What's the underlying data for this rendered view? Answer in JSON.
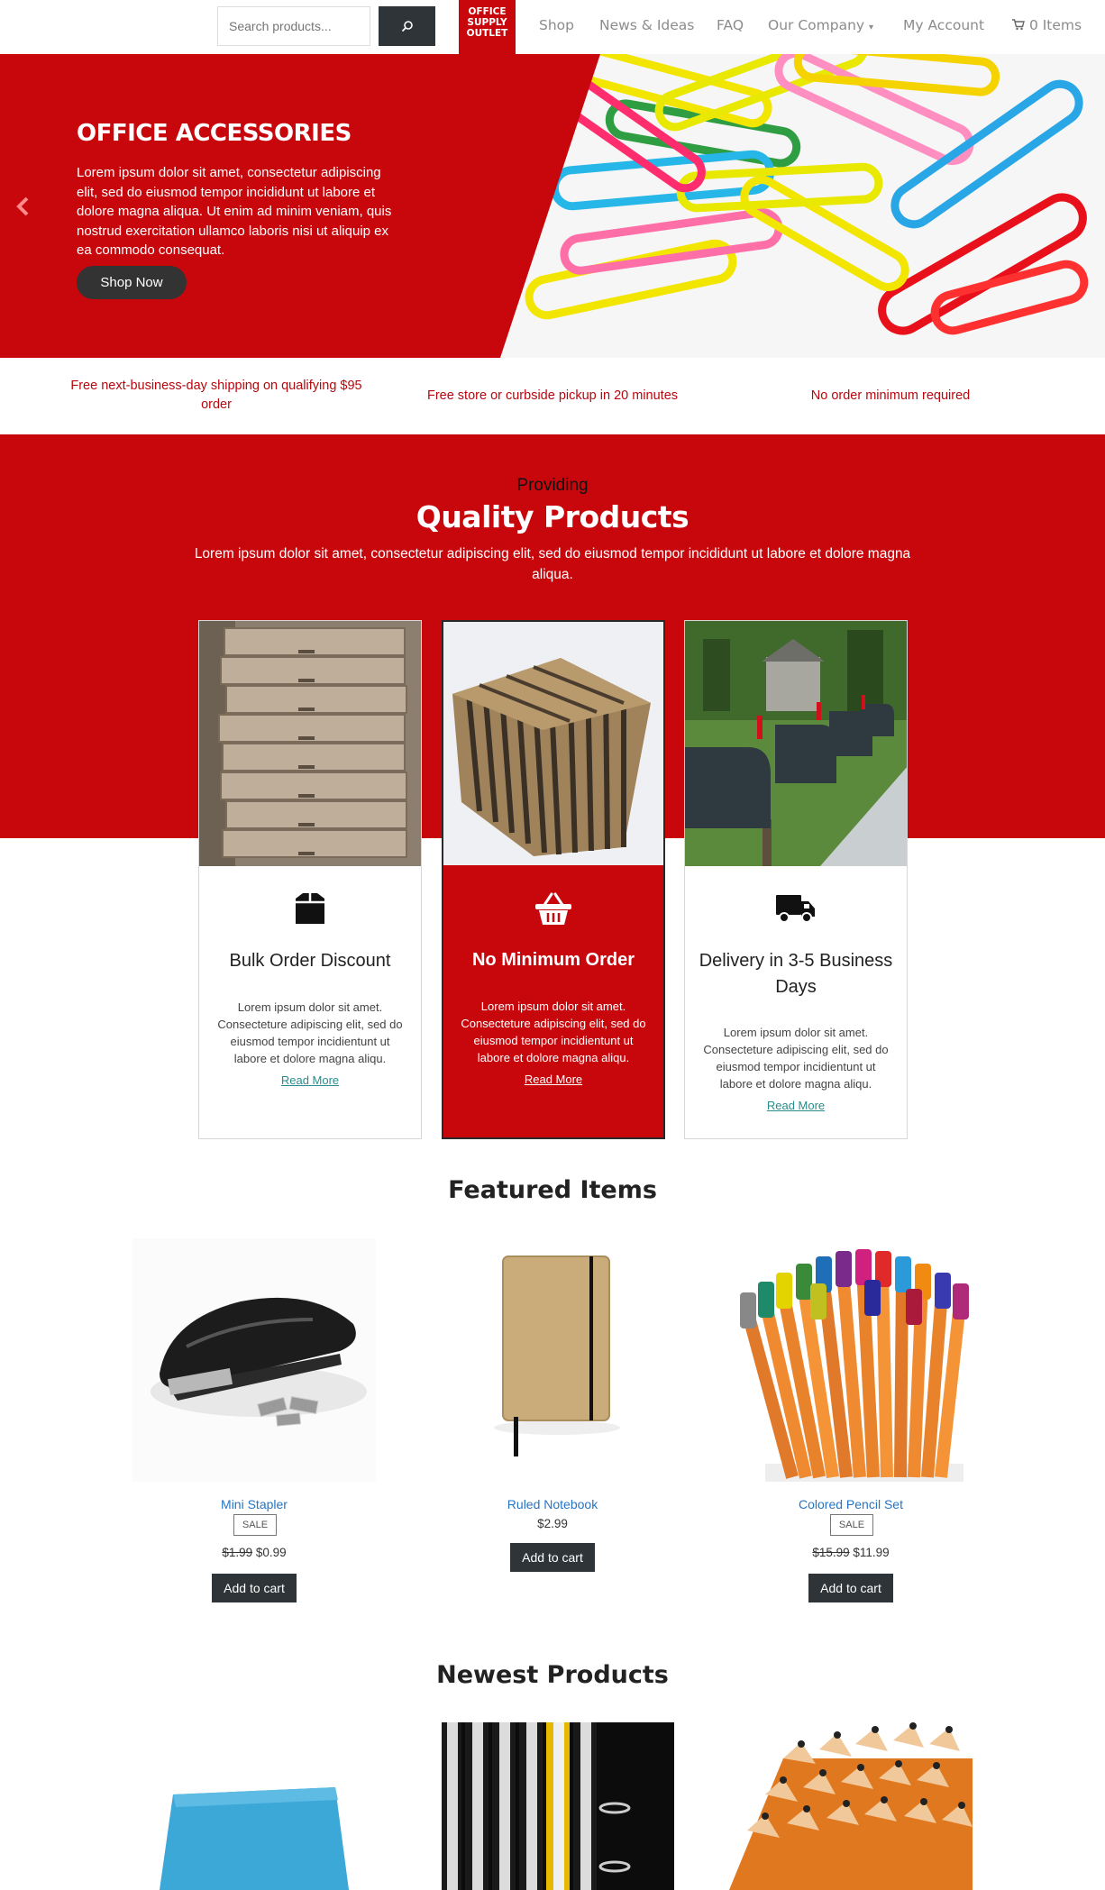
{
  "header": {
    "search_placeholder": "Search products...",
    "logo_line1": "OFFICE",
    "logo_line2": "SUPPLY",
    "logo_line3": "OUTLET",
    "nav": [
      "Shop",
      "News & Ideas",
      "FAQ",
      "Our Company",
      "My Account"
    ],
    "cart_label": "0 Items"
  },
  "hero": {
    "title": "OFFICE ACCESSORIES",
    "text": "Lorem ipsum dolor sit amet, consectetur adipiscing elit, sed do eiusmod tempor incididunt ut labore et dolore magna aliqua. Ut enim ad minim veniam, quis nostrud exercitation ullamco laboris nisi ut aliquip ex ea commodo consequat.",
    "button": "Shop Now"
  },
  "features": [
    "Free next-business-day shipping on qualifying $95 order",
    "Free store or curbside pickup in 20 minutes",
    "No order minimum required"
  ],
  "quality": {
    "kicker": "Providing",
    "title": "Quality Products",
    "text": "Lorem ipsum dolor sit amet, consectetur adipiscing elit, sed do eiusmod tempor incididunt ut labore et dolore magna aliqua.",
    "cards": [
      {
        "title": "Bulk Order Discount",
        "body": "Lorem ipsum dolor sit amet. Consecteture adipiscing elit, sed do eiusmod tempor incidientunt ut labore et dolore magna aliqu.",
        "link": "Read More"
      },
      {
        "title": "No Minimum Order",
        "body": "Lorem ipsum dolor sit amet. Consecteture adipiscing elit, sed do eiusmod tempor incidientunt ut labore et dolore magna aliqu.",
        "link": "Read More"
      },
      {
        "title": "Delivery in 3-5 Business Days",
        "body": "Lorem ipsum dolor sit amet. Consecteture adipiscing elit, sed do eiusmod tempor incidientunt ut labore et dolore magna aliqu.",
        "link": "Read More"
      }
    ]
  },
  "featured": {
    "title": "Featured Items",
    "items": [
      {
        "name": "Mini Stapler",
        "badge": "SALE",
        "old_price": "$1.99",
        "price": "$0.99",
        "button": "Add to cart"
      },
      {
        "name": "Ruled Notebook",
        "price": "$2.99",
        "button": "Add to cart"
      },
      {
        "name": "Colored Pencil Set",
        "badge": "SALE",
        "old_price": "$15.99",
        "price": "$11.99",
        "button": "Add to cart"
      }
    ]
  },
  "newest": {
    "title": "Newest Products"
  },
  "colors": {
    "brand_red": "#c8070d",
    "dark_button": "#2f3438",
    "link_blue": "#2774c4",
    "link_teal": "#2a8c8c"
  }
}
